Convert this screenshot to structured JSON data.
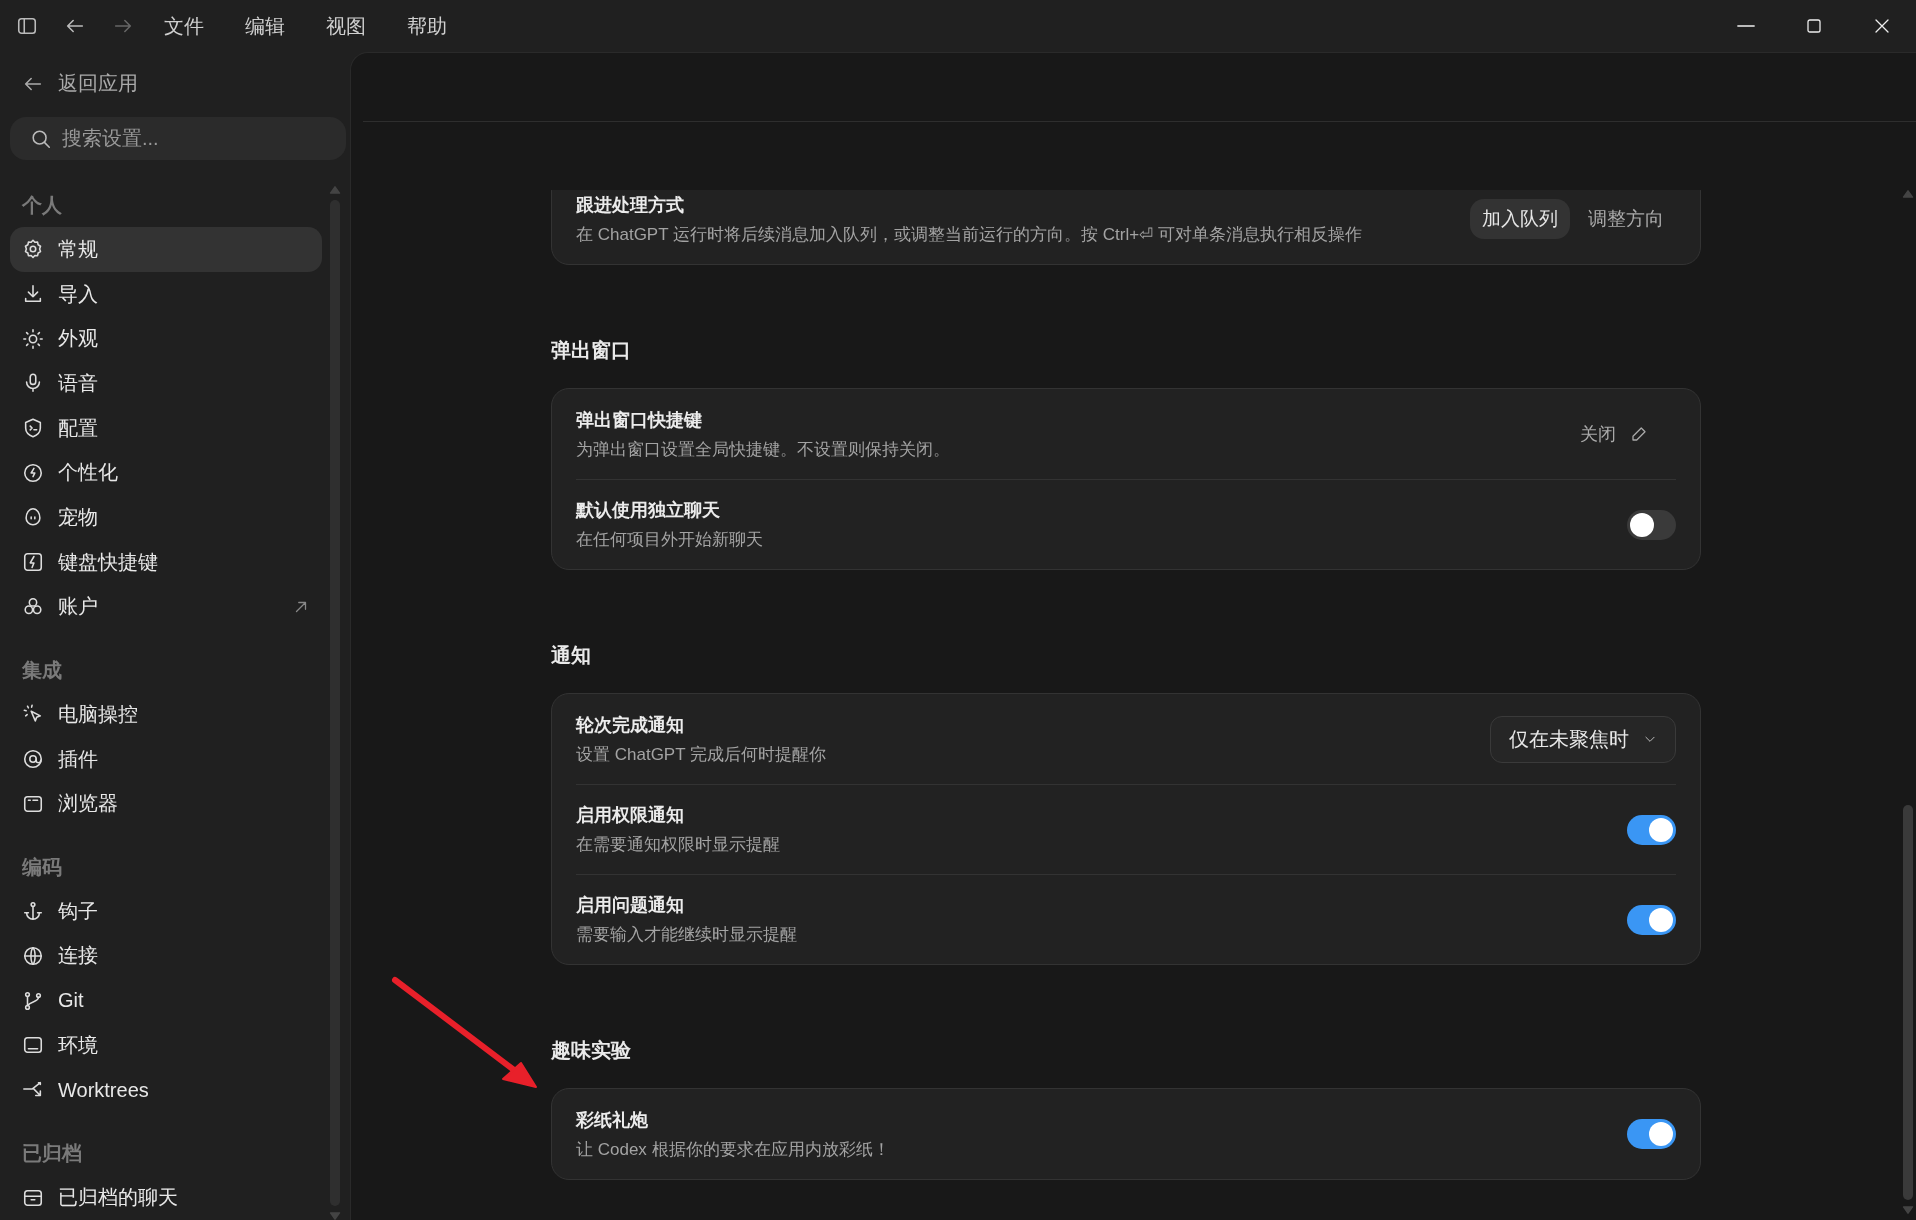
{
  "titlebar": {
    "nav": {
      "back_disabled": false,
      "forward_disabled": true
    },
    "menus": [
      "文件",
      "编辑",
      "视图",
      "帮助"
    ]
  },
  "sidebar": {
    "back_link": "返回应用",
    "search": {
      "placeholder": "搜索设置..."
    },
    "sections": [
      {
        "title": "个人",
        "items": [
          {
            "label": "常规",
            "selected": true,
            "external": false
          },
          {
            "label": "导入",
            "selected": false,
            "external": false
          },
          {
            "label": "外观",
            "selected": false,
            "external": false
          },
          {
            "label": "语音",
            "selected": false,
            "external": false
          },
          {
            "label": "配置",
            "selected": false,
            "external": false
          },
          {
            "label": "个性化",
            "selected": false,
            "external": false
          },
          {
            "label": "宠物",
            "selected": false,
            "external": false
          },
          {
            "label": "键盘快捷键",
            "selected": false,
            "external": false
          },
          {
            "label": "账户",
            "selected": false,
            "external": true
          }
        ]
      },
      {
        "title": "集成",
        "items": [
          {
            "label": "电脑操控",
            "selected": false,
            "external": false
          },
          {
            "label": "插件",
            "selected": false,
            "external": false
          },
          {
            "label": "浏览器",
            "selected": false,
            "external": false
          }
        ]
      },
      {
        "title": "编码",
        "items": [
          {
            "label": "钩子",
            "selected": false,
            "external": false
          },
          {
            "label": "连接",
            "selected": false,
            "external": false
          },
          {
            "label": "Git",
            "selected": false,
            "external": false
          },
          {
            "label": "环境",
            "selected": false,
            "external": false
          },
          {
            "label": "Worktrees",
            "selected": false,
            "external": false
          }
        ]
      },
      {
        "title": "已归档",
        "items": [
          {
            "label": "已归档的聊天",
            "selected": false,
            "external": false
          }
        ]
      }
    ]
  },
  "content": {
    "groups": [
      {
        "rows": [
          {
            "kind": "segmented",
            "title": "跟进处理方式",
            "description": "在 ChatGPT 运行时将后续消息加入队列，或调整当前运行的方向。按 Ctrl+⏎ 可对单条消息执行相反操作",
            "options": [
              {
                "label": "加入队列",
                "selected": true
              },
              {
                "label": "调整方向",
                "selected": false
              }
            ]
          }
        ]
      },
      {
        "title": "弹出窗口",
        "rows": [
          {
            "kind": "shortcut",
            "title": "弹出窗口快捷键",
            "description": "为弹出窗口设置全局快捷键。不设置则保持关闭。",
            "value": "关闭"
          },
          {
            "kind": "toggle",
            "title": "默认使用独立聊天",
            "description": "在任何项目外开始新聊天",
            "on": false
          }
        ]
      },
      {
        "title": "通知",
        "rows": [
          {
            "kind": "dropdown",
            "title": "轮次完成通知",
            "description": "设置 ChatGPT 完成后何时提醒你",
            "value": "仅在未聚焦时"
          },
          {
            "kind": "toggle",
            "title": "启用权限通知",
            "description": "在需要通知权限时显示提醒",
            "on": true
          },
          {
            "kind": "toggle",
            "title": "启用问题通知",
            "description": "需要输入才能继续时显示提醒",
            "on": true
          }
        ]
      },
      {
        "title": "趣味实验",
        "rows": [
          {
            "kind": "toggle",
            "title": "彩纸礼炮",
            "description": "让 Codex 根据你的要求在应用内放彩纸！",
            "on": true
          }
        ]
      }
    ]
  },
  "annotation": {
    "kind": "arrow"
  }
}
